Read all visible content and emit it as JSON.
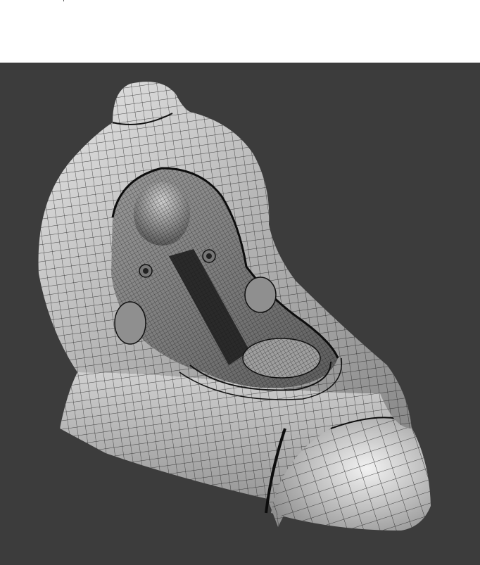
{
  "colors": {
    "page_background": "#ffffff",
    "viewport_background": "#3c3c3c",
    "mesh_surface_light": "#d9d9d9",
    "mesh_surface_mid": "#9c9c9c",
    "mesh_surface_dark": "#4a4a4a",
    "wireframe_lines": "#111111"
  },
  "viewport": {
    "content": "3d-wireframe-mesh",
    "shading": "gray-smooth-with-wireframe-overlay"
  },
  "icons": {
    "model": "mesh-model-icon"
  }
}
